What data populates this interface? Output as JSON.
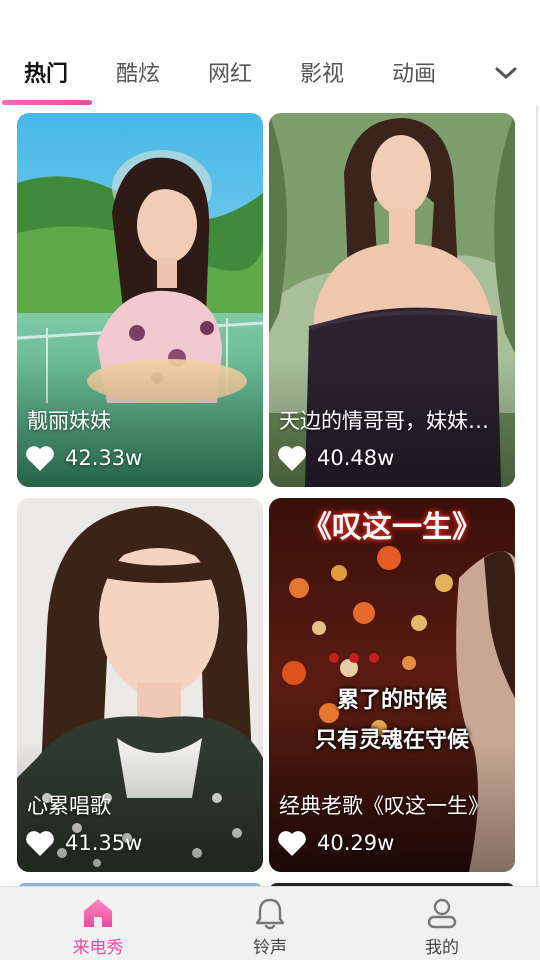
{
  "tabs": [
    {
      "label": "热门",
      "active": true
    },
    {
      "label": "酷炫",
      "active": false
    },
    {
      "label": "网红",
      "active": false
    },
    {
      "label": "影视",
      "active": false
    },
    {
      "label": "动画",
      "active": false
    }
  ],
  "more_icon": "chevron-down-icon",
  "accent_color": "#ef4aa0",
  "cards": [
    {
      "title": "靓丽妹妹",
      "likes": "42.33w"
    },
    {
      "title": "天边的情哥哥，妹妹…",
      "likes": "40.48w"
    },
    {
      "title": "心累唱歌",
      "likes": "41.35w"
    },
    {
      "title": "经典老歌《叹这一生》",
      "likes": "40.29w",
      "overlay_title": "《叹这一生》",
      "lyric_lines": [
        "累了的时候",
        "只有灵魂在守候"
      ]
    }
  ],
  "like_icon": "heart-icon",
  "bottom_nav": [
    {
      "label": "来电秀",
      "icon": "home-icon",
      "active": true
    },
    {
      "label": "铃声",
      "icon": "bell-icon",
      "active": false
    },
    {
      "label": "我的",
      "icon": "profile-icon",
      "active": false
    }
  ]
}
